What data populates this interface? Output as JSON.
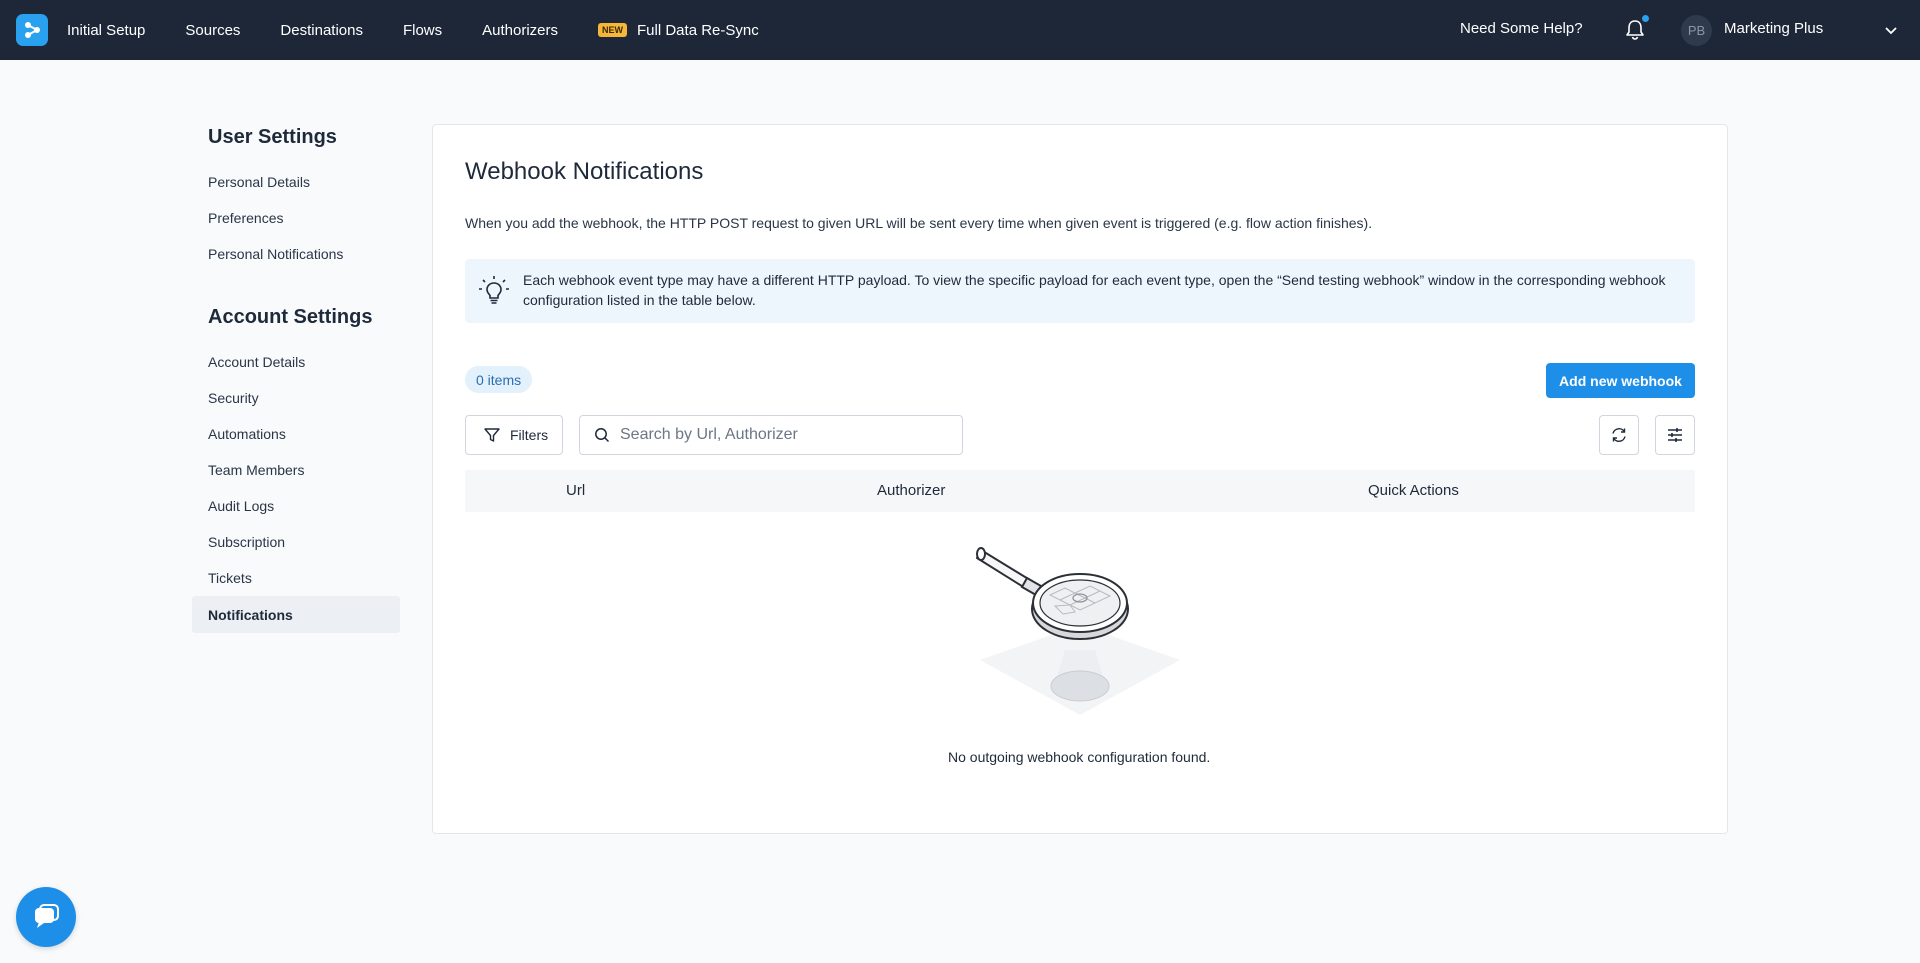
{
  "topbar": {
    "nav": [
      "Initial Setup",
      "Sources",
      "Destinations",
      "Flows",
      "Authorizers"
    ],
    "new_badge": "NEW",
    "resync_label": "Full Data Re-Sync",
    "help": "Need Some Help?",
    "avatar_initials": "PB",
    "account_name": "Marketing Plus",
    "colors": {
      "bar": "#1d2737",
      "accent": "#2aa1ef",
      "badge": "#f5b63a"
    }
  },
  "sidebar": {
    "user_heading": "User Settings",
    "user_items": [
      "Personal Details",
      "Preferences",
      "Personal Notifications"
    ],
    "account_heading": "Account Settings",
    "account_items": [
      "Account Details",
      "Security",
      "Automations",
      "Team Members",
      "Audit Logs",
      "Subscription",
      "Tickets",
      "Notifications"
    ],
    "active_item": "Notifications"
  },
  "main": {
    "title": "Webhook Notifications",
    "description": "When you add the webhook, the HTTP POST request to given URL will be sent every time when given event is triggered (e.g. flow action finishes).",
    "info": "Each webhook event type may have a different HTTP payload. To view the specific payload for each event type, open the “Send testing webhook” window in the corresponding webhook configuration listed in the table below.",
    "items_count": "0 items",
    "add_button": "Add new webhook",
    "filters_button": "Filters",
    "search_placeholder": "Search by Url, Authorizer",
    "columns": [
      "Url",
      "Authorizer",
      "Quick Actions"
    ],
    "empty_message": "No outgoing webhook configuration found.",
    "icons": [
      "lightbulb-icon",
      "filter-icon",
      "search-icon",
      "refresh-icon",
      "settings-sliders-icon",
      "chat-icon"
    ]
  }
}
